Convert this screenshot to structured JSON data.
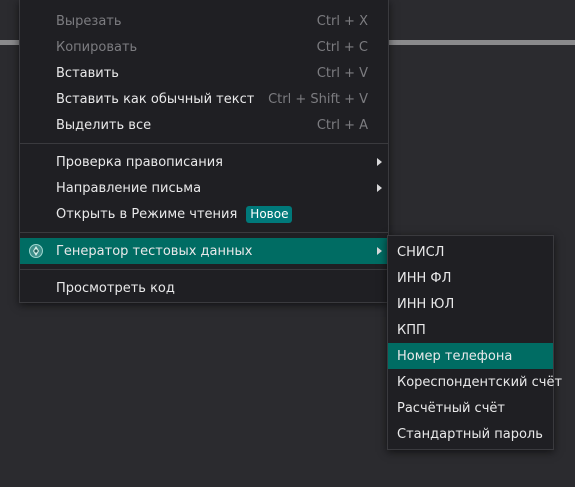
{
  "context_menu": {
    "items": [
      {
        "label": "Вырезать",
        "shortcut": "Ctrl + X"
      },
      {
        "label": "Копировать",
        "shortcut": "Ctrl + C"
      },
      {
        "label": "Вставить",
        "shortcut": "Ctrl + V"
      },
      {
        "label": "Вставить как обычный текст",
        "shortcut": "Ctrl + Shift + V"
      },
      {
        "label": "Выделить все",
        "shortcut": "Ctrl + A"
      },
      {
        "label": "Проверка правописания"
      },
      {
        "label": "Направление письма"
      },
      {
        "label": "Открыть в Режиме чтения",
        "badge": "Новое"
      },
      {
        "label": "Генератор тестовых данных"
      },
      {
        "label": "Просмотреть код"
      }
    ]
  },
  "submenu": {
    "items": [
      {
        "label": "СНИСЛ"
      },
      {
        "label": "ИНН ФЛ"
      },
      {
        "label": "ИНН ЮЛ"
      },
      {
        "label": "КПП"
      },
      {
        "label": "Номер телефона"
      },
      {
        "label": "Кореспондентский счёт"
      },
      {
        "label": "Расчётный счёт"
      },
      {
        "label": "Стандартный пароль"
      }
    ]
  },
  "colors": {
    "highlight": "#006c63",
    "badge": "#00797a",
    "menu_bg": "#1f1f23",
    "page_bg": "#2b2b2f"
  },
  "icons": {
    "test-data-generator": "extension-icon"
  }
}
